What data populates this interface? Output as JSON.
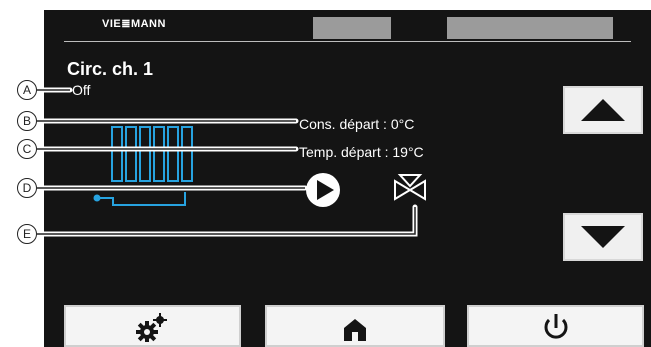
{
  "header": {
    "brand": "VIE≣MANN"
  },
  "circuit": {
    "title": "Circ. ch. 1",
    "status": "Off"
  },
  "values": {
    "setpoint": "Cons. départ : 0°C",
    "temperature": "Temp. départ : 19°C"
  },
  "callouts": [
    "A",
    "B",
    "C",
    "D",
    "E"
  ],
  "icons": {
    "radiator": "radiator-icon",
    "pump": "pump-play-icon",
    "valve": "mixing-valve-icon",
    "up": "arrow-up-icon",
    "down": "arrow-down-icon",
    "settings": "gears-icon",
    "home": "home-icon",
    "power": "power-icon"
  },
  "colors": {
    "screen": "#141414",
    "radiator": "#27a3e0"
  }
}
